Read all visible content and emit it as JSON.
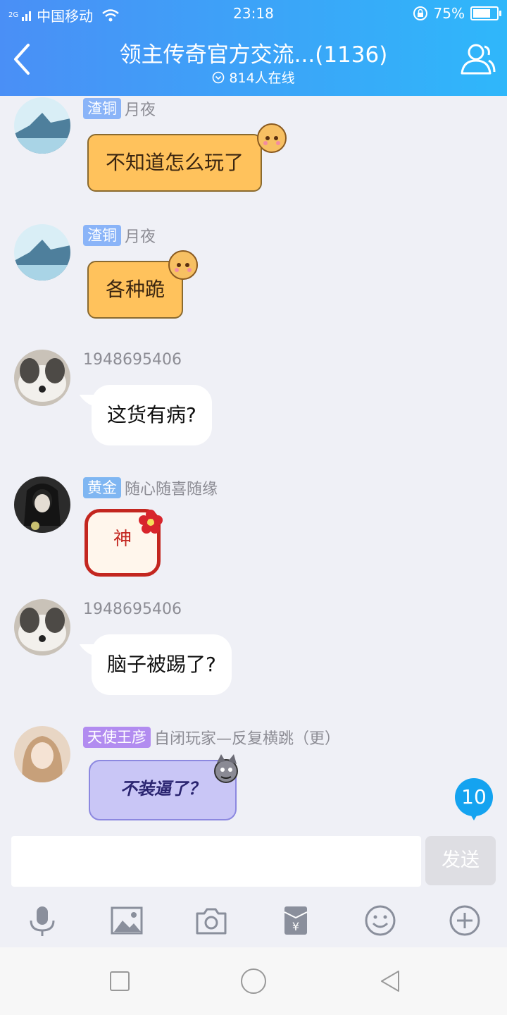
{
  "status_bar": {
    "network": "2G",
    "carrier": "中国移动",
    "time": "23:18",
    "battery": "75%"
  },
  "header": {
    "title": "领主传奇官方交流...(1136)",
    "online": "814人在线"
  },
  "messages": [
    {
      "badge": "渣铜",
      "badge_color": "#8ab4f8",
      "name": "月夜",
      "text": "不知道怎么玩了",
      "style": "orange"
    },
    {
      "badge": "渣铜",
      "badge_color": "#8ab4f8",
      "name": "月夜",
      "text": "各种跪",
      "style": "orange"
    },
    {
      "name": "1948695406",
      "text": "这货有病?",
      "style": "white"
    },
    {
      "badge": "黄金",
      "badge_color": "#7fb6f2",
      "name": "随心随喜随缘",
      "sticker_text": "神",
      "style": "sticker"
    },
    {
      "name": "1948695406",
      "text": "脑子被踢了?",
      "style": "white"
    },
    {
      "badge": "天使王彦",
      "badge_color": "#b28cf0",
      "name": "自闭玩家—反复横跳（更）",
      "text": "不装逼了？",
      "style": "purple"
    }
  ],
  "unread_count": "10",
  "composer": {
    "placeholder": "",
    "send_label": "发送"
  },
  "toolbar": [
    "microphone-icon",
    "image-icon",
    "camera-icon",
    "red-packet-icon",
    "emoji-icon",
    "plus-icon"
  ]
}
